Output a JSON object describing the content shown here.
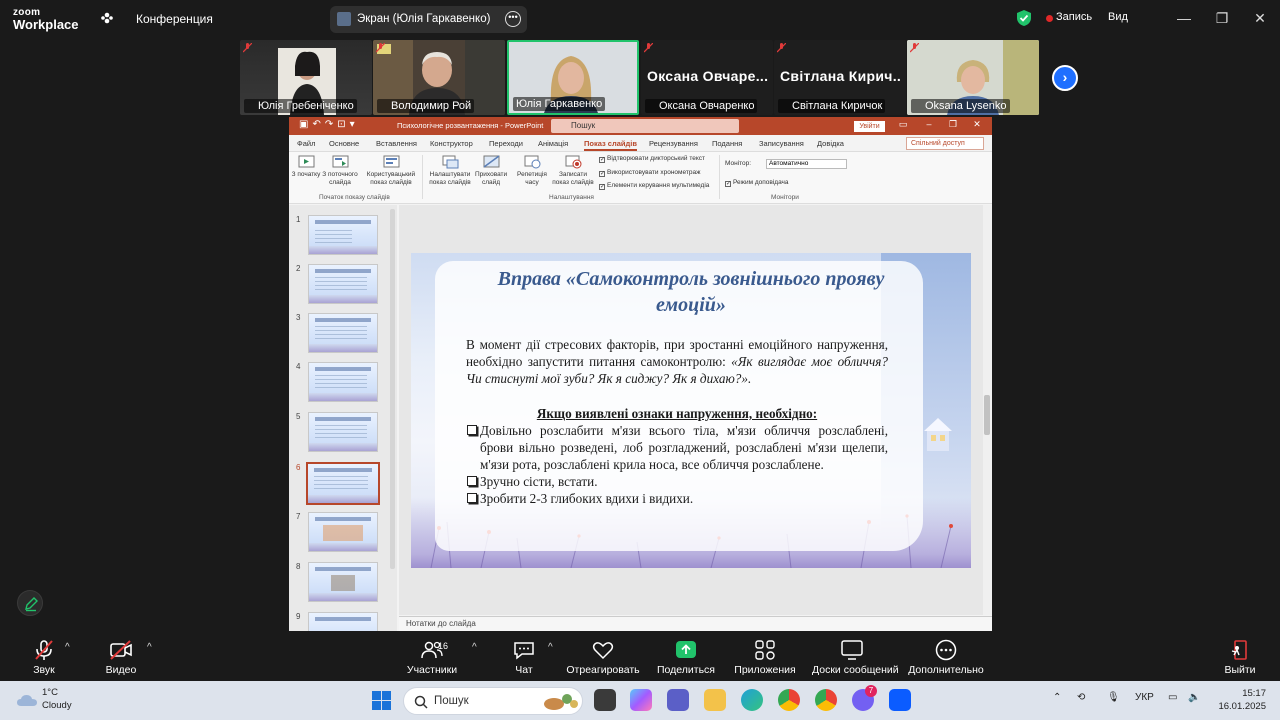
{
  "zoom": {
    "logo_line1": "zoom",
    "logo_line2": "Workplace",
    "conference_label": "Конференция",
    "screen_share_label": "Экран (Юлія Гаркавенко)",
    "record_label": "Запись",
    "view_label": "Вид",
    "accent_color": "#21c36b"
  },
  "participants": [
    {
      "name": "Юлія Гребеніченко",
      "muted": true
    },
    {
      "name": "Володимир Рой",
      "muted": true
    },
    {
      "name": "Юлія Гаркавенко",
      "muted": false,
      "active": true
    },
    {
      "name": "Оксана Овчаренко",
      "muted": true,
      "big_name": "Оксана Овчаре..."
    },
    {
      "name": "Світлана Киричок",
      "muted": true,
      "big_name": "Світлана Кирич..."
    },
    {
      "name": "Oksana Lysenko",
      "muted": true
    }
  ],
  "ppt": {
    "filename": "Психологічне розвантаження - PowerPoint",
    "search_placeholder": "Пошук",
    "signin": "Увійти",
    "share": "Спільний доступ",
    "tabs": [
      "Файл",
      "Основне",
      "Вставлення",
      "Конструктор",
      "Переходи",
      "Анімація",
      "Показ слайдів",
      "Рецензування",
      "Подання",
      "Записування",
      "Довідка"
    ],
    "active_tab": "Показ слайдів",
    "ribbon": {
      "btn_start": "З початку",
      "btn_current": "З поточного слайда",
      "btn_custom": "Користувацький показ слайдів",
      "group1": "Початок показу слайдів",
      "btn_setup": "Налаштувати показ слайдів",
      "btn_hide": "Приховати слайд",
      "btn_rehearse": "Репетиція часу",
      "btn_record": "Записати показ слайдів",
      "chk_narration": "Відтворювати дикторський текст",
      "chk_timings": "Використовувати хронометраж",
      "chk_controls": "Елементи керування мультимедіа",
      "group2": "Налаштування",
      "monitor_label": "Монітор:",
      "monitor_value": "Автоматично",
      "chk_presenter": "Режим доповідача",
      "group3": "Монітори"
    },
    "slide_numbers": [
      "1",
      "2",
      "3",
      "4",
      "5",
      "6",
      "7",
      "8",
      "9"
    ],
    "selected_slide": "6",
    "notes_label": "Нотатки до слайда"
  },
  "slide": {
    "title": "Вправа «Самоконтроль зовнішнього прояву емоцій»",
    "body_plain": "В момент дії стресових факторів, при зростанні емоційного напруження, необхідно запустити питання самоконтролю: ",
    "body_italic": "«Як виглядає моє обличчя? Чи стиснуті мої зуби? Як я сиджу? Як я дихаю?».",
    "heading": "Якщо виявлені ознаки напруження, необхідно:",
    "items": [
      "Довільно розслабити м'язи всього тіла, м'язи обличчя розслаблені, брови вільно розведені, лоб розгладжений, розслаблені м'язи щелепи, м'язи рота, розслаблені крила носа, все обличчя розслаблене.",
      "Зручно сісти, встати.",
      "Зробити 2-3 глибоких вдихи і видихи."
    ]
  },
  "toolbar": {
    "audio": "Звук",
    "video": "Видео",
    "participants": "Участники",
    "participants_count": "16",
    "chat": "Чат",
    "react": "Отреагировать",
    "share": "Поделиться",
    "apps": "Приложения",
    "whiteboards": "Доски сообщений",
    "more": "Дополнительно",
    "leave": "Выйти"
  },
  "taskbar": {
    "temp": "1°C",
    "condition": "Cloudy",
    "search": "Пошук",
    "lang": "УКР",
    "time": "15:17",
    "date": "16.01.2025",
    "badge_count": "7"
  }
}
